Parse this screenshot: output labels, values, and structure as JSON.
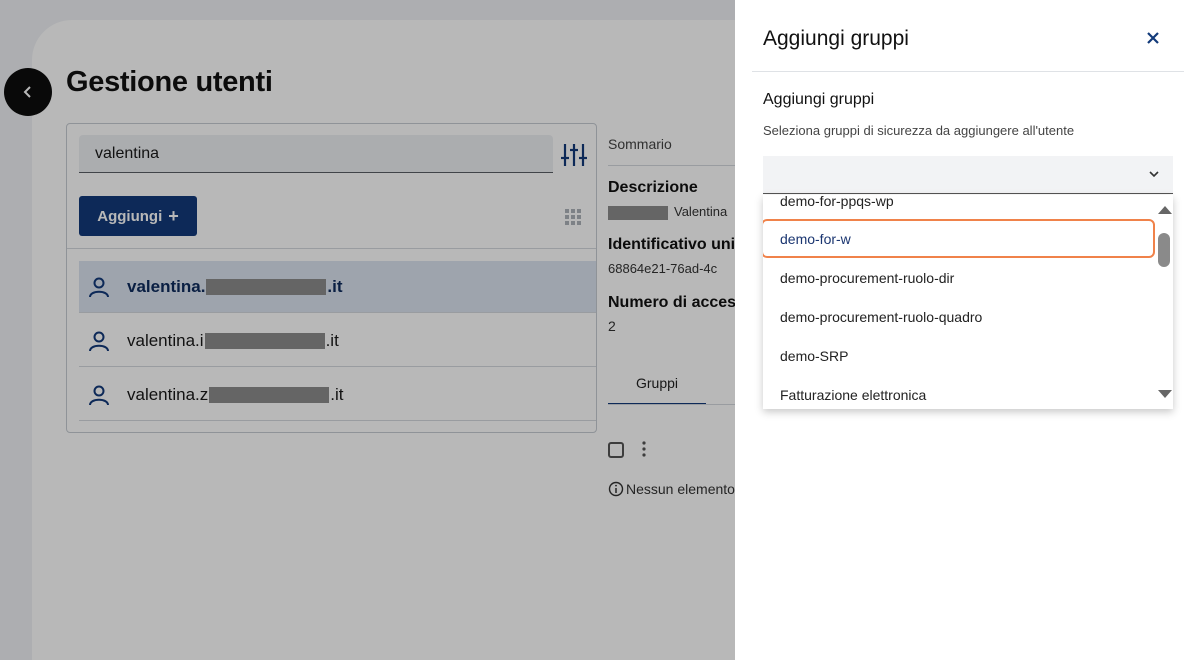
{
  "page": {
    "title": "Gestione utenti",
    "search_value": "valentina",
    "add_button_label": "Aggiungi",
    "users": [
      {
        "prefix": "valentina.",
        "suffix": ".it"
      },
      {
        "prefix": "valentina.i",
        "suffix": ".it"
      },
      {
        "prefix": "valentina.z",
        "suffix": ".it"
      }
    ]
  },
  "detail": {
    "summary_label": "Sommario",
    "description_label": "Descrizione",
    "description_value": "Valentina",
    "identifier_label": "Identificativo univoco",
    "identifier_value": "68864e21-76ad-4c",
    "access_count_label": "Numero di accessi",
    "access_count_value": "2",
    "tab_groups": "Gruppi",
    "empty_text": "Nessun elemento"
  },
  "drawer": {
    "title": "Aggiungi gruppi",
    "field_label": "Aggiungi gruppi",
    "field_hint": "Seleziona gruppi di sicurezza da aggiungere all'utente",
    "select_value": "",
    "options": [
      "demo-for-ppqs-wp",
      "demo-for-w",
      "demo-procurement-ruolo-dir",
      "demo-procurement-ruolo-quadro",
      "demo-SRP",
      "Fatturazione elettronica"
    ]
  },
  "colors": {
    "primary": "#123a7a",
    "highlight": "#f0824a",
    "selected_row": "#dbe3f0"
  }
}
